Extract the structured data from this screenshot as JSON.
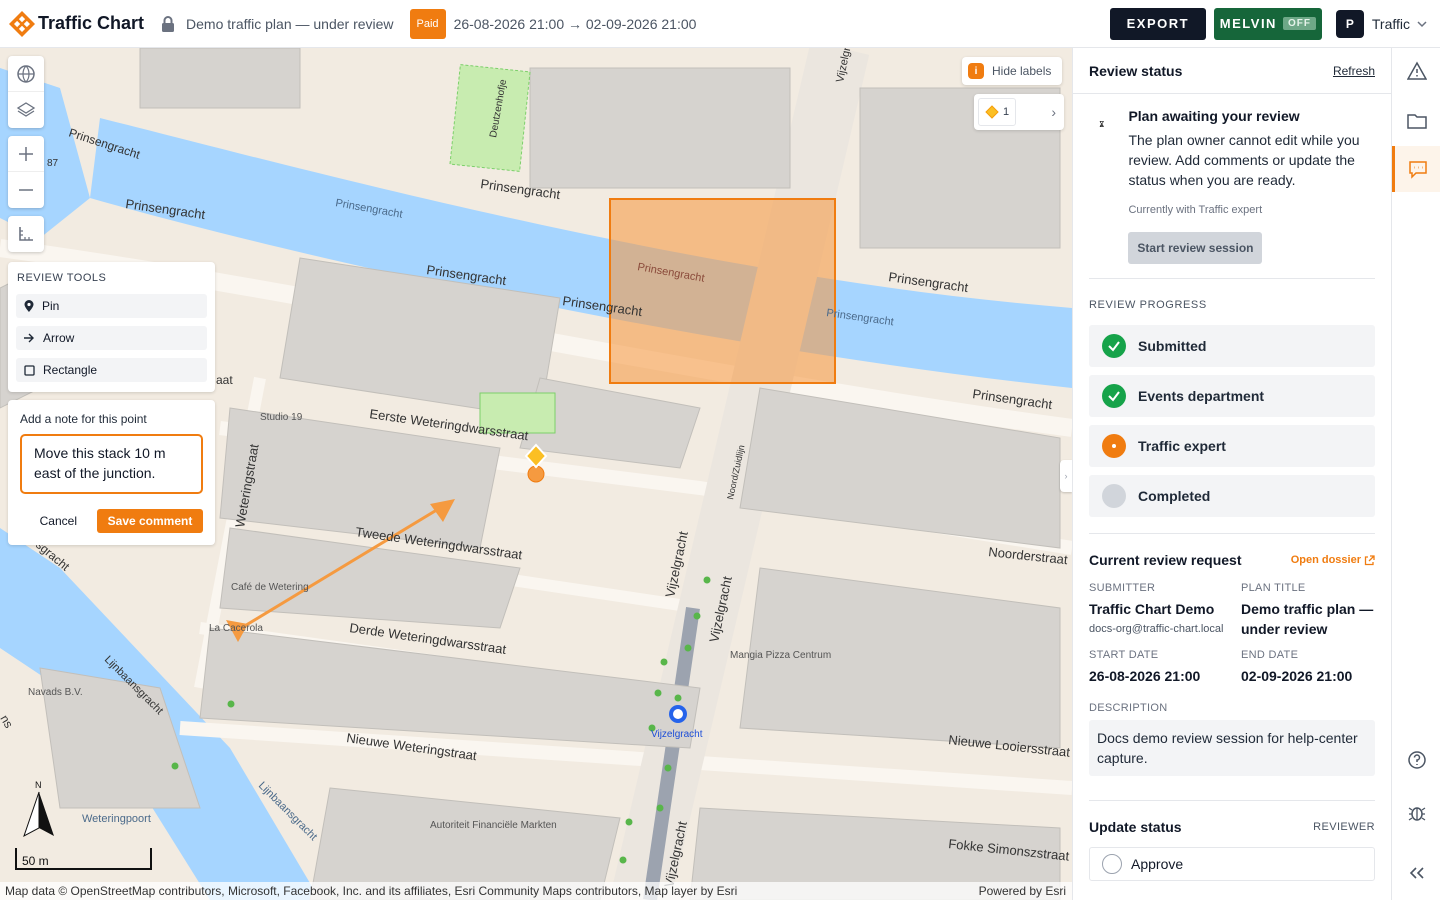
{
  "app": {
    "name": "Traffic Chart",
    "brand_color": "#f07c10"
  },
  "header": {
    "plan_title": "Demo traffic plan — under review",
    "paid_badge": "Paid",
    "dates": "26-08-2026 21:00 → 02-09-2026 21:00",
    "export_label": "EXPORT",
    "melvin_label": "MELVIN",
    "melvin_status": "OFF",
    "avatar_initial": "P",
    "workspace": "Traffic"
  },
  "map": {
    "review_tools": {
      "title": "REVIEW TOOLS",
      "items": [
        {
          "label": "Pin",
          "icon": "pin-icon"
        },
        {
          "label": "Arrow",
          "icon": "arrow-right-icon"
        },
        {
          "label": "Rectangle",
          "icon": "rectangle-icon"
        }
      ]
    },
    "note": {
      "label": "Add a note for this point",
      "value": "Move this stack 10 m east of the junction.",
      "cancel": "Cancel",
      "save": "Save comment"
    },
    "hide_labels": "Hide labels",
    "layer_count": "1",
    "scale": "50 m",
    "compass_label": "N",
    "attribution": "Map data © OpenStreetMap contributors, Microsoft, Facebook, Inc. and its affiliates, Esri Community Maps contributors, Map layer by Esri",
    "powered_by": "Powered by Esri",
    "labels": {
      "prinsengracht": "Prinsengracht",
      "deutzenhofje": "Deutzenhofje",
      "eerste": "Eerste Weteringdwarsstraat",
      "tweede": "Tweede Weteringdwarsstraat",
      "derde": "Derde Weteringdwarsstraat",
      "nieuwe_wetering": "Nieuwe Weteringstraat",
      "weteringstraat": "Weteringstraat",
      "vijzelgracht": "Vijzelgracht",
      "vijzel_station": "Vijzelgracht",
      "noorder": "Noorderstraat",
      "nieuwe_looiers": "Nieuwe Looiersstraat",
      "fokke": "Fokke Simonszstraat",
      "noord_zuidlijn": "Noord/Zuidlijn",
      "ljinbaansgracht": "Lijnbaansgracht",
      "studio": "Studio 19",
      "cafe": "Café de Wetering",
      "cacerola": "La Cacerola",
      "navads": "Navads B.V.",
      "mangia": "Mangia Pizza Centrum",
      "autoriteit": "Autoriteit Financiële Markten",
      "weteringpoort": "Weteringpoort",
      "number87": "87",
      "aat": "aat",
      "ns": "ns",
      "sgracht": "sgracht"
    }
  },
  "panel": {
    "title": "Review status",
    "refresh": "Refresh",
    "awaiting": {
      "title": "Plan awaiting your review",
      "text": "The plan owner cannot edit while you review. Add comments or update the status when you are ready.",
      "sub": "Currently with Traffic expert",
      "button": "Start review session"
    },
    "progress": {
      "title": "REVIEW PROGRESS",
      "steps": [
        {
          "label": "Submitted",
          "state": "done"
        },
        {
          "label": "Events department",
          "state": "done"
        },
        {
          "label": "Traffic expert",
          "state": "current"
        },
        {
          "label": "Completed",
          "state": "pending"
        }
      ]
    },
    "request": {
      "title": "Current review request",
      "link": "Open dossier",
      "submitter_k": "SUBMITTER",
      "submitter_v": "Traffic Chart Demo",
      "submitter_email": "docs-org@traffic-chart.local",
      "plan_title_k": "PLAN TITLE",
      "plan_title_v": "Demo traffic plan — under review",
      "start_k": "START DATE",
      "start_v": "26-08-2026 21:00",
      "end_k": "END DATE",
      "end_v": "02-09-2026 21:00",
      "description_k": "DESCRIPTION",
      "description_v": "Docs demo review session for help-center capture."
    },
    "update": {
      "title": "Update status",
      "role": "REVIEWER",
      "option": "Approve"
    }
  },
  "colors": {
    "done": "#16a34a",
    "current": "#f07c10",
    "pending": "#d1d5db",
    "water": "#a6d5ff",
    "block": "#d6d3cf"
  }
}
